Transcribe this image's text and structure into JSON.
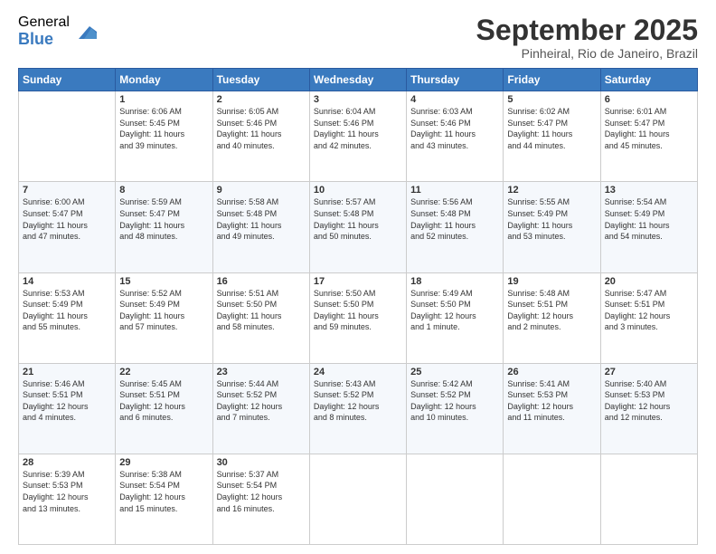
{
  "header": {
    "logo_general": "General",
    "logo_blue": "Blue",
    "month_title": "September 2025",
    "location": "Pinheiral, Rio de Janeiro, Brazil"
  },
  "days_of_week": [
    "Sunday",
    "Monday",
    "Tuesday",
    "Wednesday",
    "Thursday",
    "Friday",
    "Saturday"
  ],
  "weeks": [
    [
      {
        "day": "",
        "info": ""
      },
      {
        "day": "1",
        "info": "Sunrise: 6:06 AM\nSunset: 5:45 PM\nDaylight: 11 hours\nand 39 minutes."
      },
      {
        "day": "2",
        "info": "Sunrise: 6:05 AM\nSunset: 5:46 PM\nDaylight: 11 hours\nand 40 minutes."
      },
      {
        "day": "3",
        "info": "Sunrise: 6:04 AM\nSunset: 5:46 PM\nDaylight: 11 hours\nand 42 minutes."
      },
      {
        "day": "4",
        "info": "Sunrise: 6:03 AM\nSunset: 5:46 PM\nDaylight: 11 hours\nand 43 minutes."
      },
      {
        "day": "5",
        "info": "Sunrise: 6:02 AM\nSunset: 5:47 PM\nDaylight: 11 hours\nand 44 minutes."
      },
      {
        "day": "6",
        "info": "Sunrise: 6:01 AM\nSunset: 5:47 PM\nDaylight: 11 hours\nand 45 minutes."
      }
    ],
    [
      {
        "day": "7",
        "info": "Sunrise: 6:00 AM\nSunset: 5:47 PM\nDaylight: 11 hours\nand 47 minutes."
      },
      {
        "day": "8",
        "info": "Sunrise: 5:59 AM\nSunset: 5:47 PM\nDaylight: 11 hours\nand 48 minutes."
      },
      {
        "day": "9",
        "info": "Sunrise: 5:58 AM\nSunset: 5:48 PM\nDaylight: 11 hours\nand 49 minutes."
      },
      {
        "day": "10",
        "info": "Sunrise: 5:57 AM\nSunset: 5:48 PM\nDaylight: 11 hours\nand 50 minutes."
      },
      {
        "day": "11",
        "info": "Sunrise: 5:56 AM\nSunset: 5:48 PM\nDaylight: 11 hours\nand 52 minutes."
      },
      {
        "day": "12",
        "info": "Sunrise: 5:55 AM\nSunset: 5:49 PM\nDaylight: 11 hours\nand 53 minutes."
      },
      {
        "day": "13",
        "info": "Sunrise: 5:54 AM\nSunset: 5:49 PM\nDaylight: 11 hours\nand 54 minutes."
      }
    ],
    [
      {
        "day": "14",
        "info": "Sunrise: 5:53 AM\nSunset: 5:49 PM\nDaylight: 11 hours\nand 55 minutes."
      },
      {
        "day": "15",
        "info": "Sunrise: 5:52 AM\nSunset: 5:49 PM\nDaylight: 11 hours\nand 57 minutes."
      },
      {
        "day": "16",
        "info": "Sunrise: 5:51 AM\nSunset: 5:50 PM\nDaylight: 11 hours\nand 58 minutes."
      },
      {
        "day": "17",
        "info": "Sunrise: 5:50 AM\nSunset: 5:50 PM\nDaylight: 11 hours\nand 59 minutes."
      },
      {
        "day": "18",
        "info": "Sunrise: 5:49 AM\nSunset: 5:50 PM\nDaylight: 12 hours\nand 1 minute."
      },
      {
        "day": "19",
        "info": "Sunrise: 5:48 AM\nSunset: 5:51 PM\nDaylight: 12 hours\nand 2 minutes."
      },
      {
        "day": "20",
        "info": "Sunrise: 5:47 AM\nSunset: 5:51 PM\nDaylight: 12 hours\nand 3 minutes."
      }
    ],
    [
      {
        "day": "21",
        "info": "Sunrise: 5:46 AM\nSunset: 5:51 PM\nDaylight: 12 hours\nand 4 minutes."
      },
      {
        "day": "22",
        "info": "Sunrise: 5:45 AM\nSunset: 5:51 PM\nDaylight: 12 hours\nand 6 minutes."
      },
      {
        "day": "23",
        "info": "Sunrise: 5:44 AM\nSunset: 5:52 PM\nDaylight: 12 hours\nand 7 minutes."
      },
      {
        "day": "24",
        "info": "Sunrise: 5:43 AM\nSunset: 5:52 PM\nDaylight: 12 hours\nand 8 minutes."
      },
      {
        "day": "25",
        "info": "Sunrise: 5:42 AM\nSunset: 5:52 PM\nDaylight: 12 hours\nand 10 minutes."
      },
      {
        "day": "26",
        "info": "Sunrise: 5:41 AM\nSunset: 5:53 PM\nDaylight: 12 hours\nand 11 minutes."
      },
      {
        "day": "27",
        "info": "Sunrise: 5:40 AM\nSunset: 5:53 PM\nDaylight: 12 hours\nand 12 minutes."
      }
    ],
    [
      {
        "day": "28",
        "info": "Sunrise: 5:39 AM\nSunset: 5:53 PM\nDaylight: 12 hours\nand 13 minutes."
      },
      {
        "day": "29",
        "info": "Sunrise: 5:38 AM\nSunset: 5:54 PM\nDaylight: 12 hours\nand 15 minutes."
      },
      {
        "day": "30",
        "info": "Sunrise: 5:37 AM\nSunset: 5:54 PM\nDaylight: 12 hours\nand 16 minutes."
      },
      {
        "day": "",
        "info": ""
      },
      {
        "day": "",
        "info": ""
      },
      {
        "day": "",
        "info": ""
      },
      {
        "day": "",
        "info": ""
      }
    ]
  ]
}
